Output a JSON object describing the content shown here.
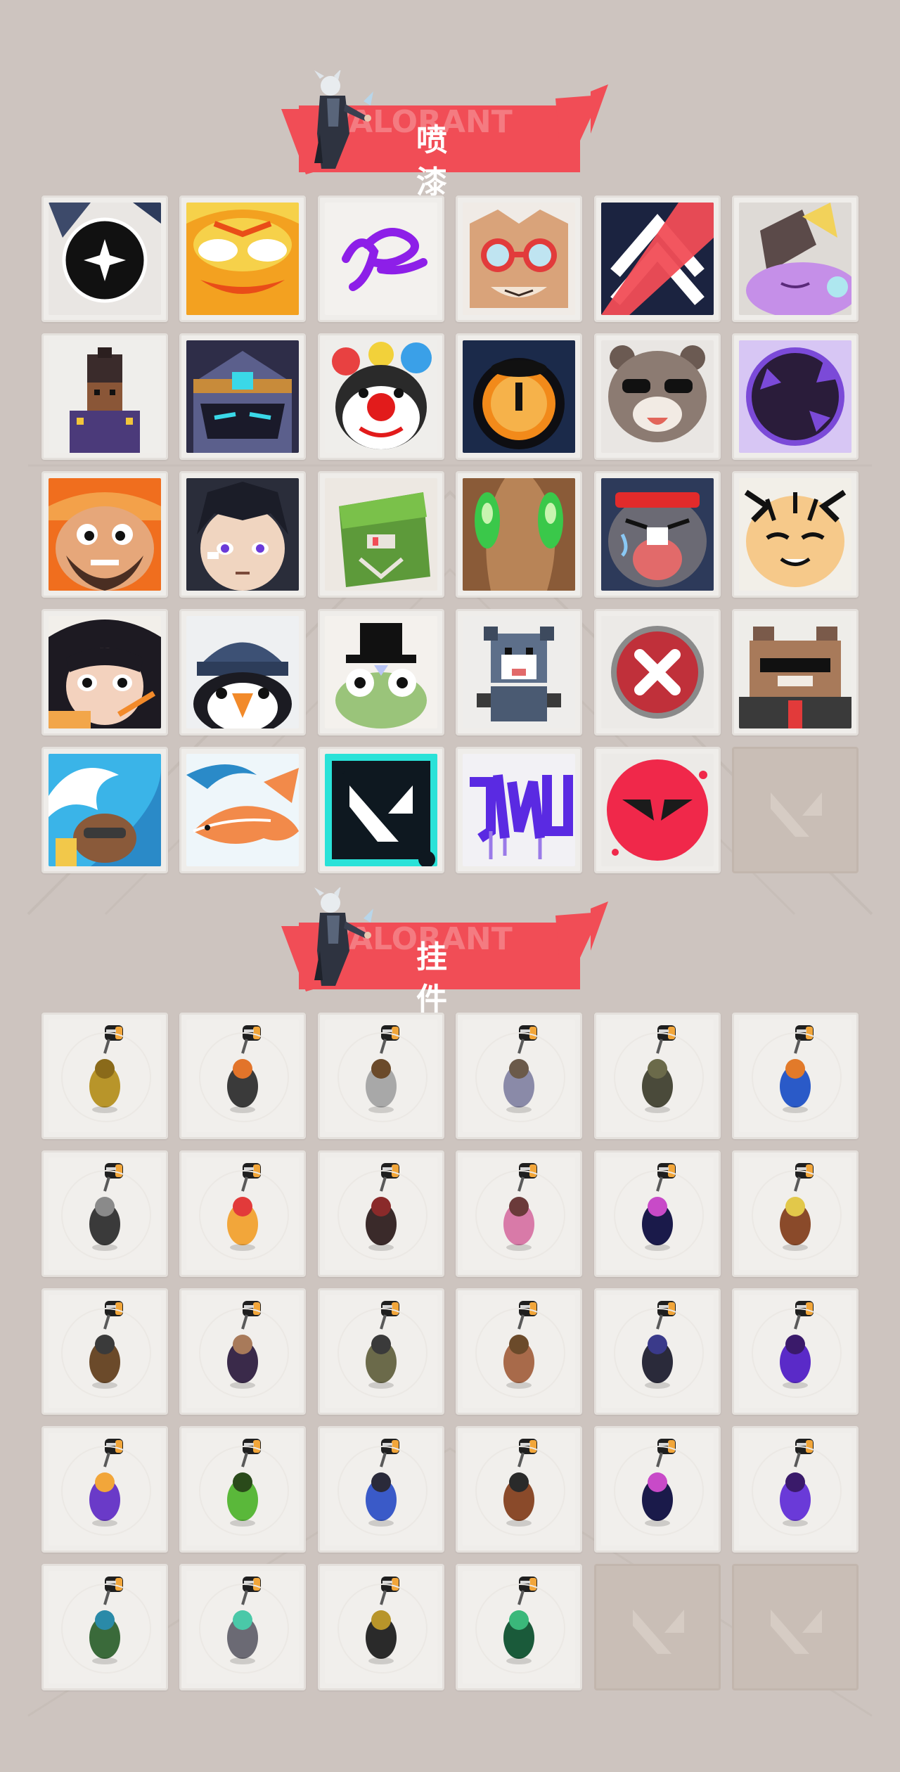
{
  "sections": [
    {
      "id": "sprays",
      "title": "喷 漆",
      "items": [
        {
          "name": "spray-black-star",
          "kind": "spray"
        },
        {
          "name": "spray-orange-mask",
          "kind": "spray"
        },
        {
          "name": "spray-purple-scribble",
          "kind": "spray"
        },
        {
          "name": "spray-goggles-cat",
          "kind": "spray"
        },
        {
          "name": "spray-chevron-logo",
          "kind": "spray"
        },
        {
          "name": "spray-purple-creature",
          "kind": "spray"
        },
        {
          "name": "spray-pixel-agent",
          "kind": "spray"
        },
        {
          "name": "spray-armored-helmet",
          "kind": "spray"
        },
        {
          "name": "spray-clown-face",
          "kind": "spray"
        },
        {
          "name": "spray-orange-dial",
          "kind": "spray"
        },
        {
          "name": "spray-sunglasses-bear",
          "kind": "spray"
        },
        {
          "name": "spray-purple-void",
          "kind": "spray"
        },
        {
          "name": "spray-bearded-man",
          "kind": "spray"
        },
        {
          "name": "spray-black-hair-boy",
          "kind": "spray"
        },
        {
          "name": "spray-green-crate",
          "kind": "spray"
        },
        {
          "name": "spray-green-eyes",
          "kind": "spray"
        },
        {
          "name": "spray-crying-seal",
          "kind": "spray"
        },
        {
          "name": "spray-tiger-face",
          "kind": "spray"
        },
        {
          "name": "spray-woman-pencil",
          "kind": "spray"
        },
        {
          "name": "spray-penguin-beanie",
          "kind": "spray"
        },
        {
          "name": "spray-frog-hat",
          "kind": "spray"
        },
        {
          "name": "spray-pixel-raccoon",
          "kind": "spray"
        },
        {
          "name": "spray-red-x",
          "kind": "spray"
        },
        {
          "name": "spray-pixel-cat-shades",
          "kind": "spray"
        },
        {
          "name": "spray-wave-bear",
          "kind": "spray"
        },
        {
          "name": "spray-koi-fish",
          "kind": "spray"
        },
        {
          "name": "spray-valorant-logo-teal",
          "kind": "spray"
        },
        {
          "name": "spray-purple-graffiti",
          "kind": "spray"
        },
        {
          "name": "spray-red-valorant-logo",
          "kind": "spray"
        },
        {
          "name": "spray-empty-slot",
          "kind": "empty"
        }
      ]
    },
    {
      "id": "buddies",
      "title": "挂 件",
      "items": [
        {
          "name": "buddy-gold-cat",
          "kind": "buddy"
        },
        {
          "name": "buddy-robot-camera",
          "kind": "buddy"
        },
        {
          "name": "buddy-bathtub",
          "kind": "buddy"
        },
        {
          "name": "buddy-raccoon-figure",
          "kind": "buddy"
        },
        {
          "name": "buddy-pouch",
          "kind": "buddy"
        },
        {
          "name": "buddy-blue-canister",
          "kind": "buddy"
        },
        {
          "name": "buddy-chain-sword",
          "kind": "buddy"
        },
        {
          "name": "buddy-candy-corn",
          "kind": "buddy"
        },
        {
          "name": "buddy-rope-knot",
          "kind": "buddy"
        },
        {
          "name": "buddy-cupcake",
          "kind": "buddy"
        },
        {
          "name": "buddy-ep9-medal",
          "kind": "buddy"
        },
        {
          "name": "buddy-teddy-bear",
          "kind": "buddy"
        },
        {
          "name": "buddy-turret",
          "kind": "buddy"
        },
        {
          "name": "buddy-agent-figure",
          "kind": "buddy"
        },
        {
          "name": "buddy-hat-figure",
          "kind": "buddy"
        },
        {
          "name": "buddy-wooden-box",
          "kind": "buddy"
        },
        {
          "name": "buddy-dark-robot",
          "kind": "buddy"
        },
        {
          "name": "buddy-purple-blade",
          "kind": "buddy"
        },
        {
          "name": "buddy-lava-lamp",
          "kind": "buddy"
        },
        {
          "name": "buddy-green-gadget",
          "kind": "buddy"
        },
        {
          "name": "buddy-astronaut",
          "kind": "buddy"
        },
        {
          "name": "buddy-radio",
          "kind": "buddy"
        },
        {
          "name": "buddy-ep9-medal-2",
          "kind": "buddy"
        },
        {
          "name": "buddy-purple-heart",
          "kind": "buddy"
        },
        {
          "name": "buddy-green-can",
          "kind": "buddy"
        },
        {
          "name": "buddy-ufo",
          "kind": "buddy"
        },
        {
          "name": "buddy-v-badge",
          "kind": "buddy"
        },
        {
          "name": "buddy-green-gem",
          "kind": "buddy"
        },
        {
          "name": "buddy-empty-slot-1",
          "kind": "empty"
        },
        {
          "name": "buddy-empty-slot-2",
          "kind": "empty"
        }
      ]
    }
  ],
  "colors": {
    "background": "#cdc4bf",
    "accent": "#f14d56",
    "tile": "#efedea",
    "empty_tile": "#c9beb6"
  }
}
